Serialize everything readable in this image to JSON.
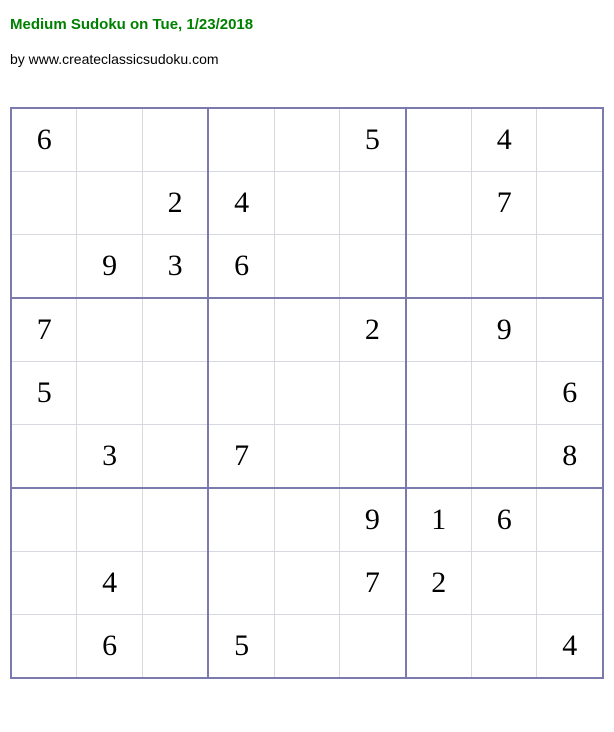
{
  "title": "Medium Sudoku on Tue, 1/23/2018",
  "byline": "by www.createclassicsudoku.com",
  "grid": [
    [
      "6",
      "",
      "",
      "",
      "",
      "5",
      "",
      "4",
      ""
    ],
    [
      "",
      "",
      "2",
      "4",
      "",
      "",
      "",
      "7",
      ""
    ],
    [
      "",
      "9",
      "3",
      "6",
      "",
      "",
      "",
      "",
      ""
    ],
    [
      "7",
      "",
      "",
      "",
      "",
      "2",
      "",
      "9",
      ""
    ],
    [
      "5",
      "",
      "",
      "",
      "",
      "",
      "",
      "",
      "6"
    ],
    [
      "",
      "3",
      "",
      "7",
      "",
      "",
      "",
      "",
      "8"
    ],
    [
      "",
      "",
      "",
      "",
      "",
      "9",
      "1",
      "6",
      ""
    ],
    [
      "",
      "4",
      "",
      "",
      "",
      "7",
      "2",
      "",
      ""
    ],
    [
      "",
      "6",
      "",
      "5",
      "",
      "",
      "",
      "",
      "4"
    ]
  ]
}
